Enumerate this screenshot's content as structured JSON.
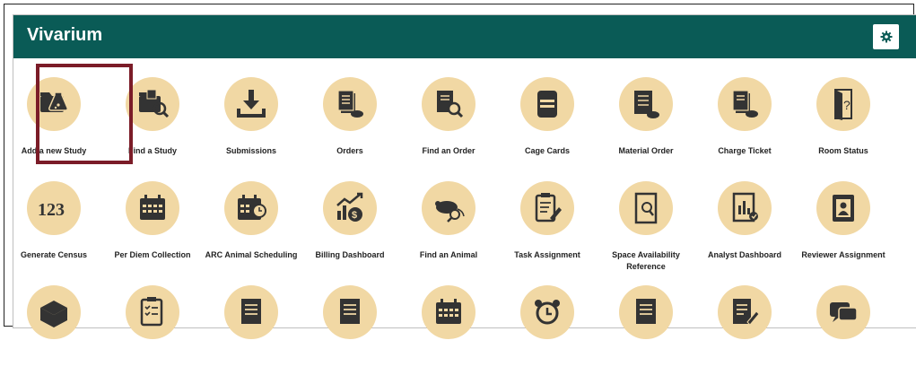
{
  "header": {
    "title": "Vivarium",
    "settings_icon": "gear-icon",
    "color": "#0a5b56"
  },
  "tile_color": "#f1d8a4",
  "icon_color": "#333333",
  "highlight_color": "#7b1c28",
  "tiles": [
    {
      "label": "Add a new Study",
      "icon": "study-flask-icon",
      "highlighted": true
    },
    {
      "label": "Find a Study",
      "icon": "find-study-icon"
    },
    {
      "label": "Submissions",
      "icon": "download-icon"
    },
    {
      "label": "Orders",
      "icon": "orders-icon"
    },
    {
      "label": "Find an Order",
      "icon": "find-order-icon"
    },
    {
      "label": "Cage Cards",
      "icon": "cage-card-icon"
    },
    {
      "label": "Material Order",
      "icon": "material-order-icon"
    },
    {
      "label": "Charge Ticket",
      "icon": "charge-ticket-icon"
    },
    {
      "label": "Room Status",
      "icon": "door-question-icon"
    },
    {
      "label": "Generate Census",
      "icon": "census-123-icon"
    },
    {
      "label": "Per Diem Collection",
      "icon": "calendar-icon"
    },
    {
      "label": "ARC Animal Scheduling",
      "icon": "calendar-clock-icon"
    },
    {
      "label": "Billing Dashboard",
      "icon": "billing-chart-icon"
    },
    {
      "label": "Find an Animal",
      "icon": "mouse-search-icon"
    },
    {
      "label": "Task Assignment",
      "icon": "clipboard-edit-icon"
    },
    {
      "label": "Space Availability Reference",
      "icon": "door-search-icon"
    },
    {
      "label": "Analyst Dashboard",
      "icon": "analyst-report-icon"
    },
    {
      "label": "Reviewer Assignment",
      "icon": "id-badge-icon"
    },
    {
      "label": "",
      "icon": "box-icon"
    },
    {
      "label": "",
      "icon": "checklist-icon"
    },
    {
      "label": "",
      "icon": "document-icon"
    },
    {
      "label": "",
      "icon": "document-icon"
    },
    {
      "label": "",
      "icon": "calendar-icon"
    },
    {
      "label": "",
      "icon": "alarm-clock-icon"
    },
    {
      "label": "",
      "icon": "document-icon"
    },
    {
      "label": "",
      "icon": "document-edit-icon"
    },
    {
      "label": "",
      "icon": "chat-icon"
    }
  ]
}
